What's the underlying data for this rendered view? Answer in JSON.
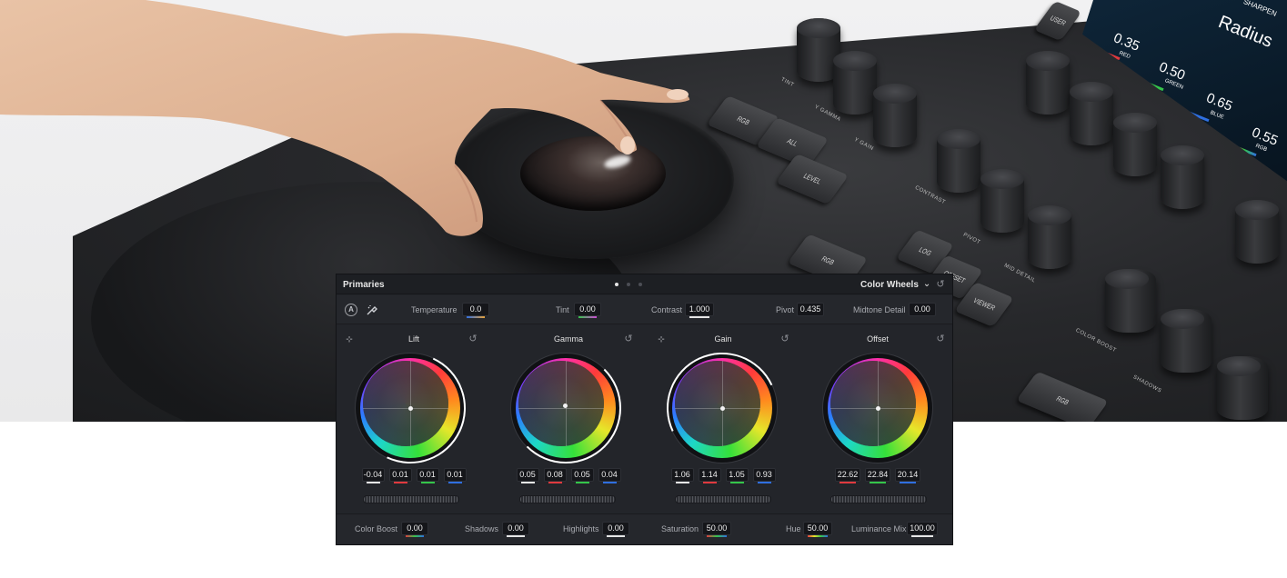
{
  "colors": {
    "panel_bg": "#23252a",
    "header_bg": "#1d1f23",
    "accent_red": "#e0393e",
    "accent_green": "#35c54a",
    "accent_blue": "#2f6fe0",
    "accent_white": "#e6e6e6",
    "wheel_arc": "#ffffff"
  },
  "hardware": {
    "screen": {
      "title": "SHARPEN",
      "param": "Radius",
      "readouts": [
        {
          "value": "0.35",
          "label": "RED"
        },
        {
          "value": "0.50",
          "label": "GREEN"
        },
        {
          "value": "0.65",
          "label": "BLUE"
        },
        {
          "value": "0.55",
          "label": "RGB"
        }
      ]
    },
    "keys": [
      "RGB",
      "ALL",
      "LEVEL",
      "RGB",
      "LOG",
      "OFFSET",
      "VIEWER",
      "USER",
      "RGB"
    ],
    "knob_labels": [
      "TINT",
      "Y GAMMA",
      "Y GAIN",
      "CONTRAST",
      "PIVOT",
      "MID DETAIL",
      "COLOR BOOST",
      "SHADOWS"
    ]
  },
  "panel": {
    "title": "Primaries",
    "mode": "Color Wheels",
    "pages": 3,
    "active_page": 0,
    "icons": {
      "auto": "A",
      "picker": "eyedropper-icon",
      "reset": "reset-icon"
    },
    "toolbar": [
      {
        "label": "Temperature",
        "value": "0.0"
      },
      {
        "label": "Tint",
        "value": "0.00"
      },
      {
        "label": "Contrast",
        "value": "1.000"
      },
      {
        "label": "Pivot",
        "value": "0.435"
      },
      {
        "label": "Midtone Detail",
        "value": "0.00"
      }
    ],
    "wheels": [
      {
        "name": "Lift",
        "values": [
          "-0.04",
          "0.01",
          "0.01",
          "0.01"
        ]
      },
      {
        "name": "Gamma",
        "values": [
          "0.05",
          "0.08",
          "0.05",
          "0.04"
        ]
      },
      {
        "name": "Gain",
        "values": [
          "1.06",
          "1.14",
          "1.05",
          "0.93"
        ]
      },
      {
        "name": "Offset",
        "values": [
          "22.62",
          "22.84",
          "20.14"
        ]
      }
    ],
    "footer": [
      {
        "label": "Color Boost",
        "value": "0.00"
      },
      {
        "label": "Shadows",
        "value": "0.00"
      },
      {
        "label": "Highlights",
        "value": "0.00"
      },
      {
        "label": "Saturation",
        "value": "50.00"
      },
      {
        "label": "Hue",
        "value": "50.00"
      },
      {
        "label": "Luminance Mix",
        "value": "100.00"
      }
    ]
  }
}
